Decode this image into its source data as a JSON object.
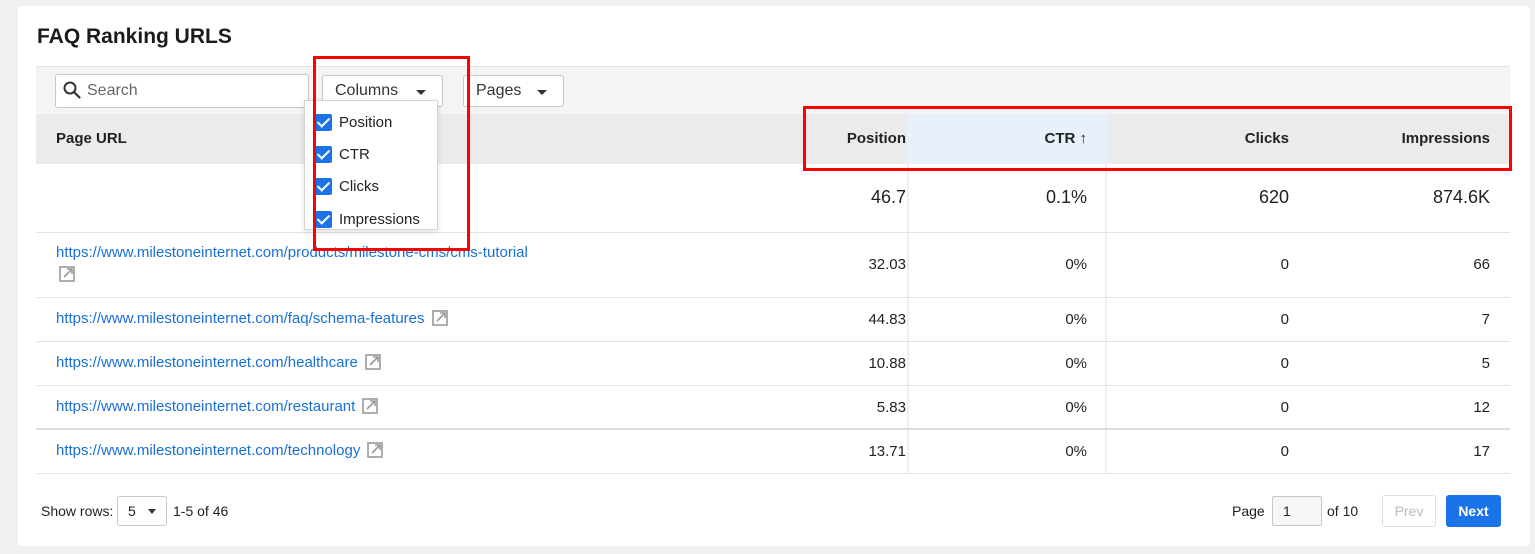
{
  "title": "FAQ Ranking URLS",
  "toolbar": {
    "search_placeholder": "Search",
    "columns_label": "Columns",
    "pages_label": "Pages"
  },
  "columns_menu": [
    {
      "label": "Position",
      "checked": true
    },
    {
      "label": "CTR",
      "checked": true
    },
    {
      "label": "Clicks",
      "checked": true
    },
    {
      "label": "Impressions",
      "checked": true
    }
  ],
  "table": {
    "headers": {
      "url": "Page URL",
      "position": "Position",
      "ctr": "CTR ↑",
      "clicks": "Clicks",
      "impressions": "Impressions"
    },
    "totals": {
      "position": "46.7",
      "ctr": "0.1%",
      "clicks": "620",
      "impressions": "874.6K"
    },
    "rows": [
      {
        "url": "https://www.milestoneinternet.com/products/milestone-cms/cms-tutorial",
        "position": "32.03",
        "ctr": "0%",
        "clicks": "0",
        "impressions": "66"
      },
      {
        "url": "https://www.milestoneinternet.com/faq/schema-features",
        "position": "44.83",
        "ctr": "0%",
        "clicks": "0",
        "impressions": "7"
      },
      {
        "url": "https://www.milestoneinternet.com/healthcare",
        "position": "10.88",
        "ctr": "0%",
        "clicks": "0",
        "impressions": "5"
      },
      {
        "url": "https://www.milestoneinternet.com/restaurant",
        "position": "5.83",
        "ctr": "0%",
        "clicks": "0",
        "impressions": "12"
      },
      {
        "url": "https://www.milestoneinternet.com/technology",
        "position": "13.71",
        "ctr": "0%",
        "clicks": "0",
        "impressions": "17"
      }
    ]
  },
  "footer": {
    "show_rows_label": "Show rows:",
    "rows_value": "5",
    "range_text": "1-5 of 46",
    "page_label": "Page",
    "page_value": "1",
    "of_text": "of 10",
    "prev_label": "Prev",
    "next_label": "Next"
  },
  "colors": {
    "accent": "#1a73e8",
    "link": "#1a6fd6",
    "highlight": "#ff0000",
    "ctr_column": "#e8f0fc"
  },
  "icons": {
    "search": "search-icon",
    "external": "external-link-icon",
    "caret": "caret-down-icon",
    "checkbox": "checkbox-checked-icon"
  }
}
